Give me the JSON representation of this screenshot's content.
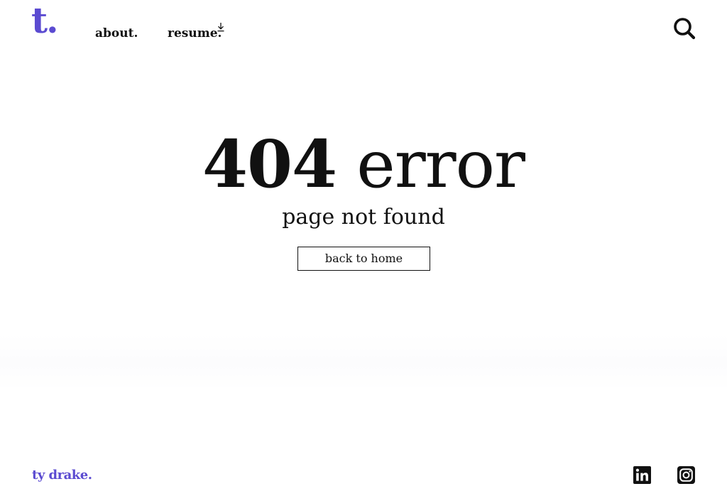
{
  "colors": {
    "brand": "#5b4bd1",
    "text": "#111111",
    "background": "#ffffff"
  },
  "header": {
    "logo": "t.",
    "nav": {
      "about": "about.",
      "resume": "resume."
    },
    "icons": {
      "resume": "download-icon",
      "search": "search-icon"
    }
  },
  "main": {
    "title_number": "404",
    "title_word": "error",
    "subtitle": "page not found",
    "back_button": "back to home"
  },
  "footer": {
    "name": "ty drake.",
    "social": [
      "linkedin-icon",
      "instagram-icon"
    ]
  }
}
